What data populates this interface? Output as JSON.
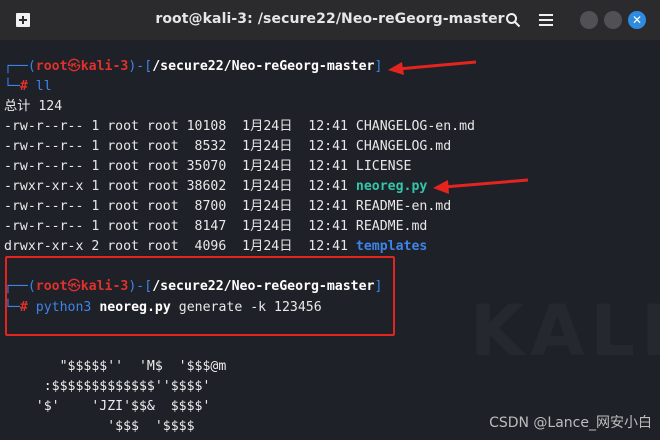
{
  "window": {
    "title": "root@kali-3: /secure22/Neo-reGeorg-master",
    "icons": [
      "new-tab-icon",
      "search-icon",
      "menu-icon",
      "minimize-icon",
      "maximize-icon",
      "close-icon"
    ]
  },
  "prompt1": {
    "top": "┌──(",
    "user": "root",
    "at": "㉿",
    "host": "kali-3",
    "mid": ")-[",
    "path": "/secure22/Neo-reGeorg-master",
    "end": "]",
    "bottom": "└─",
    "hash": "#",
    "command": "ll"
  },
  "total_line": "总计 124",
  "listing": [
    {
      "perms": "-rw-r--r--",
      "links": "1",
      "owner": "root",
      "group": "root",
      "size": "10108",
      "date": "1月24日",
      "time": "12:41",
      "name": "CHANGELOG-en.md",
      "kind": "file"
    },
    {
      "perms": "-rw-r--r--",
      "links": "1",
      "owner": "root",
      "group": "root",
      "size": " 8532",
      "date": "1月24日",
      "time": "12:41",
      "name": "CHANGELOG.md",
      "kind": "file"
    },
    {
      "perms": "-rw-r--r--",
      "links": "1",
      "owner": "root",
      "group": "root",
      "size": "35070",
      "date": "1月24日",
      "time": "12:41",
      "name": "LICENSE",
      "kind": "file"
    },
    {
      "perms": "-rwxr-xr-x",
      "links": "1",
      "owner": "root",
      "group": "root",
      "size": "38602",
      "date": "1月24日",
      "time": "12:41",
      "name": "neoreg.py",
      "kind": "exec"
    },
    {
      "perms": "-rw-r--r--",
      "links": "1",
      "owner": "root",
      "group": "root",
      "size": " 8700",
      "date": "1月24日",
      "time": "12:41",
      "name": "README-en.md",
      "kind": "file"
    },
    {
      "perms": "-rw-r--r--",
      "links": "1",
      "owner": "root",
      "group": "root",
      "size": " 8147",
      "date": "1月24日",
      "time": "12:41",
      "name": "README.md",
      "kind": "file"
    },
    {
      "perms": "drwxr-xr-x",
      "links": "2",
      "owner": "root",
      "group": "root",
      "size": " 4096",
      "date": "1月24日",
      "time": "12:41",
      "name": "templates",
      "kind": "dir"
    }
  ],
  "prompt2": {
    "top": "┌──(",
    "user": "root",
    "at": "㉿",
    "host": "kali-3",
    "mid": ")-[",
    "path": "/secure22/Neo-reGeorg-master",
    "end": "]",
    "bottom": "└─",
    "hash": "#",
    "cmd_python": "python3",
    "cmd_script": "neoreg.py",
    "cmd_args": "generate -k 123456"
  },
  "ascii_art": [
    "       \"$$$$$''  'M$  '$$$@m",
    "     :$$$$$$$$$$$$$''$$$$'",
    "    '$'    'JZI'$$&  $$$$'",
    "             '$$$  '$$$$"
  ],
  "watermark": "CSDN @Lance_网安小白",
  "colors": {
    "accent_blue": "#3d84e8",
    "prompt_red": "#e0312c",
    "exec_green": "#33c6a8",
    "annotation_red": "#e4241e"
  }
}
